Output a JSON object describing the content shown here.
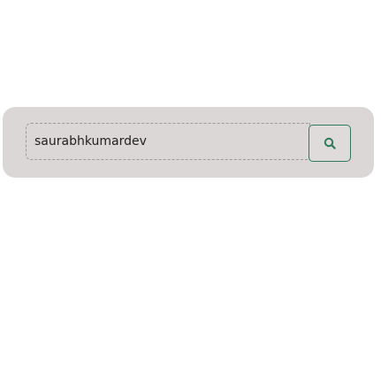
{
  "search": {
    "value": "saurabhkumardev",
    "placeholder": "",
    "button_icon": "search-icon",
    "accent_color": "#2e7a5a"
  }
}
